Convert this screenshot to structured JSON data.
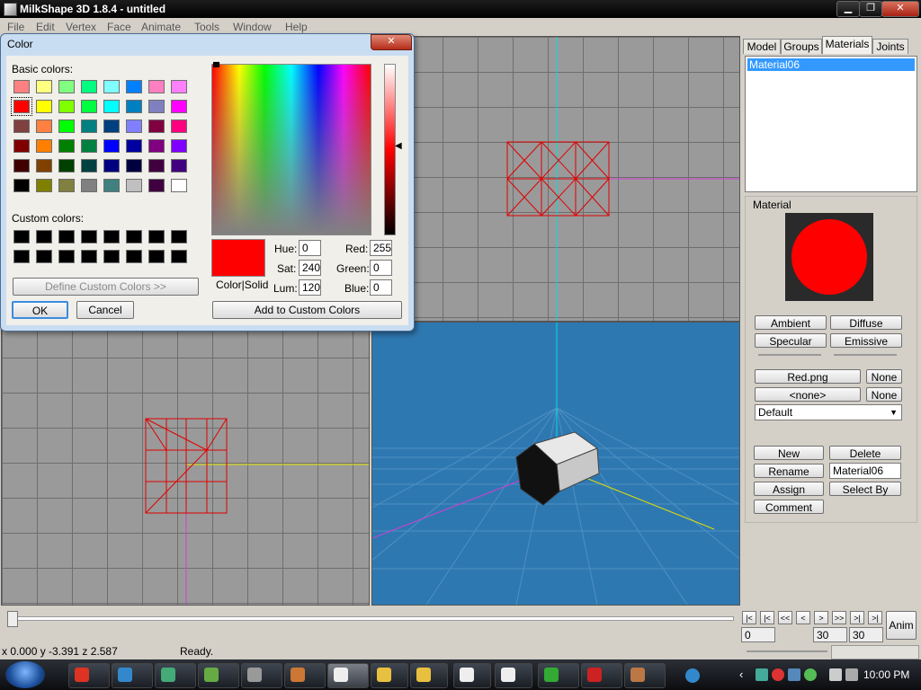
{
  "app": {
    "title": "MilkShape 3D 1.8.4 - untitled"
  },
  "menu": [
    "File",
    "Edit",
    "Vertex",
    "Face",
    "Animate",
    "Tools",
    "Window",
    "Help"
  ],
  "tabs": [
    "Model",
    "Groups",
    "Materials",
    "Joints"
  ],
  "materials_list": [
    "Material06"
  ],
  "material_panel": {
    "heading": "Material",
    "preview_color": "#ff0000",
    "ambient": "Ambient",
    "diffuse": "Diffuse",
    "specular": "Specular",
    "emissive": "Emissive",
    "texture1": "Red.png",
    "none1": "None",
    "texture2": "<none>",
    "none2": "None",
    "mode": "Default",
    "new": "New",
    "delete": "Delete",
    "rename": "Rename",
    "name_value": "Material06",
    "assign": "Assign",
    "select_by": "Select By",
    "comment": "Comment"
  },
  "dialog": {
    "title": "Color",
    "basic_colors_label": "Basic colors:",
    "custom_colors_label": "Custom colors:",
    "define_custom": "Define Custom Colors >>",
    "ok": "OK",
    "cancel": "Cancel",
    "add_custom": "Add to Custom Colors",
    "color_solid": "Color|Solid",
    "hue_label": "Hue:",
    "hue": "0",
    "sat_label": "Sat:",
    "sat": "240",
    "lum_label": "Lum:",
    "lum": "120",
    "red_label": "Red:",
    "red": "255",
    "green_label": "Green:",
    "green": "0",
    "blue_label": "Blue:",
    "blue": "0",
    "selected_color": "#ff0000",
    "basic_colors": [
      [
        "#ff8080",
        "#ffff80",
        "#80ff80",
        "#00ff80",
        "#80ffff",
        "#0080ff",
        "#ff80c0",
        "#ff80ff"
      ],
      [
        "#ff0000",
        "#ffff00",
        "#80ff00",
        "#00ff40",
        "#00ffff",
        "#0080c0",
        "#8080c0",
        "#ff00ff"
      ],
      [
        "#804040",
        "#ff8040",
        "#00ff00",
        "#008080",
        "#004080",
        "#8080ff",
        "#800040",
        "#ff0080"
      ],
      [
        "#800000",
        "#ff8000",
        "#008000",
        "#008040",
        "#0000ff",
        "#0000a0",
        "#800080",
        "#8000ff"
      ],
      [
        "#400000",
        "#804000",
        "#004000",
        "#004040",
        "#000080",
        "#000040",
        "#400040",
        "#400080"
      ],
      [
        "#000000",
        "#808000",
        "#808040",
        "#808080",
        "#408080",
        "#c0c0c0",
        "#400040",
        "#ffffff"
      ]
    ]
  },
  "timeline": {
    "frame_start": "0",
    "frame_end": "30",
    "frame_total": "30",
    "anim": "Anim",
    "nav": [
      "|<",
      "|<",
      "<<",
      "<",
      ">",
      ">>",
      ">|",
      ">|"
    ]
  },
  "status": {
    "coords": "x 0.000 y -3.391 z 2.587",
    "message": "Ready."
  },
  "taskbar": {
    "time": "10:00 PM"
  }
}
